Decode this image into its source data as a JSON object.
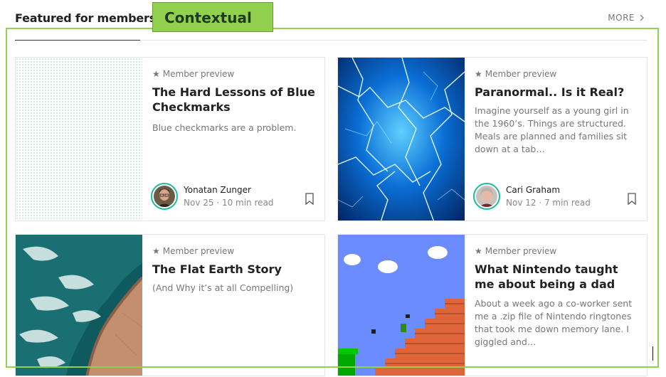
{
  "header": {
    "title": "Featured for members",
    "more_label": "MORE",
    "more_icon": "chevron-right-icon"
  },
  "annotation": {
    "label": "Contextual",
    "color": "#92d050"
  },
  "colors": {
    "accent": "#1abc9c",
    "text_primary": "#222222",
    "text_muted": "#777777"
  },
  "cards": [
    {
      "badge": "Member preview",
      "badge_icon": "star-icon",
      "title": "The Hard Lessons of Blue Checkmarks",
      "snippet": "Blue checkmarks are a problem.",
      "author": "Yonatan Zunger",
      "meta": "Nov 25 · 10 min read",
      "image": "dotted-pattern",
      "bookmark_icon": "bookmark-icon"
    },
    {
      "badge": "Member preview",
      "badge_icon": "star-icon",
      "title": "Paranormal.. Is it Real?",
      "snippet": "Imagine yourself as a young girl in the 1960’s. Things are structured. Meals are planned and families sit down at a tab…",
      "author": "Cari Graham",
      "meta": "Nov 12 · 7 min read",
      "image": "electric-lightning",
      "bookmark_icon": "bookmark-icon"
    },
    {
      "badge": "Member preview",
      "badge_icon": "star-icon",
      "title": "The Flat Earth Story",
      "snippet": "(And Why it’s at all Compelling)",
      "image": "aerial-coastline"
    },
    {
      "badge": "Member preview",
      "badge_icon": "star-icon",
      "title": "What Nintendo taught me about being a dad",
      "snippet": "About a week ago a co-worker sent me a .zip file of Nintendo ringtones that took me down memory lane. I giggled and…",
      "image": "mario-staircase"
    }
  ]
}
